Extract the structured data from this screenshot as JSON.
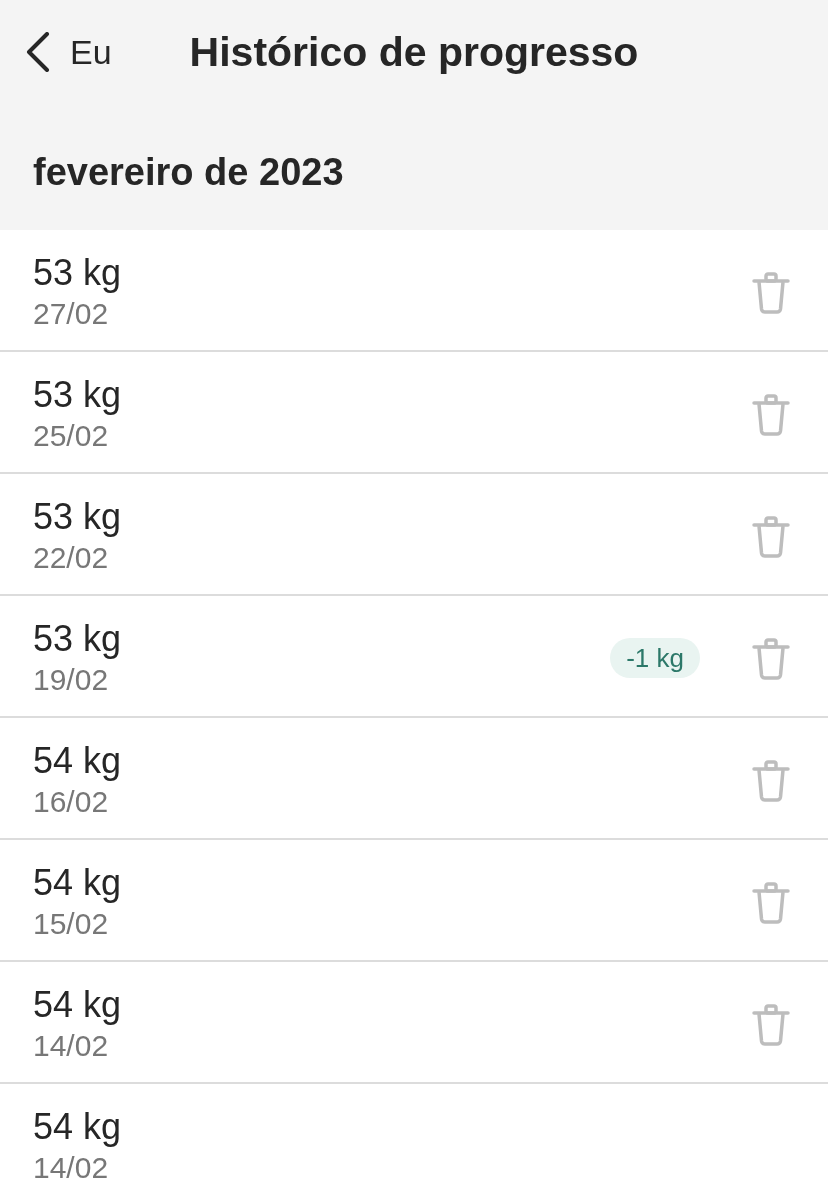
{
  "header": {
    "back_label": "Eu",
    "title": "Histórico de progresso"
  },
  "month": "fevereiro de 2023",
  "entries": [
    {
      "weight": "53 kg",
      "date": "27/02",
      "deletable": true
    },
    {
      "weight": "53 kg",
      "date": "25/02",
      "deletable": true
    },
    {
      "weight": "53 kg",
      "date": "22/02",
      "deletable": true
    },
    {
      "weight": "53 kg",
      "date": "19/02",
      "change": "-1 kg",
      "deletable": true
    },
    {
      "weight": "54 kg",
      "date": "16/02",
      "deletable": true
    },
    {
      "weight": "54 kg",
      "date": "15/02",
      "deletable": true
    },
    {
      "weight": "54 kg",
      "date": "14/02",
      "deletable": true
    },
    {
      "weight": "54 kg",
      "date": "14/02",
      "deletable": false
    }
  ]
}
